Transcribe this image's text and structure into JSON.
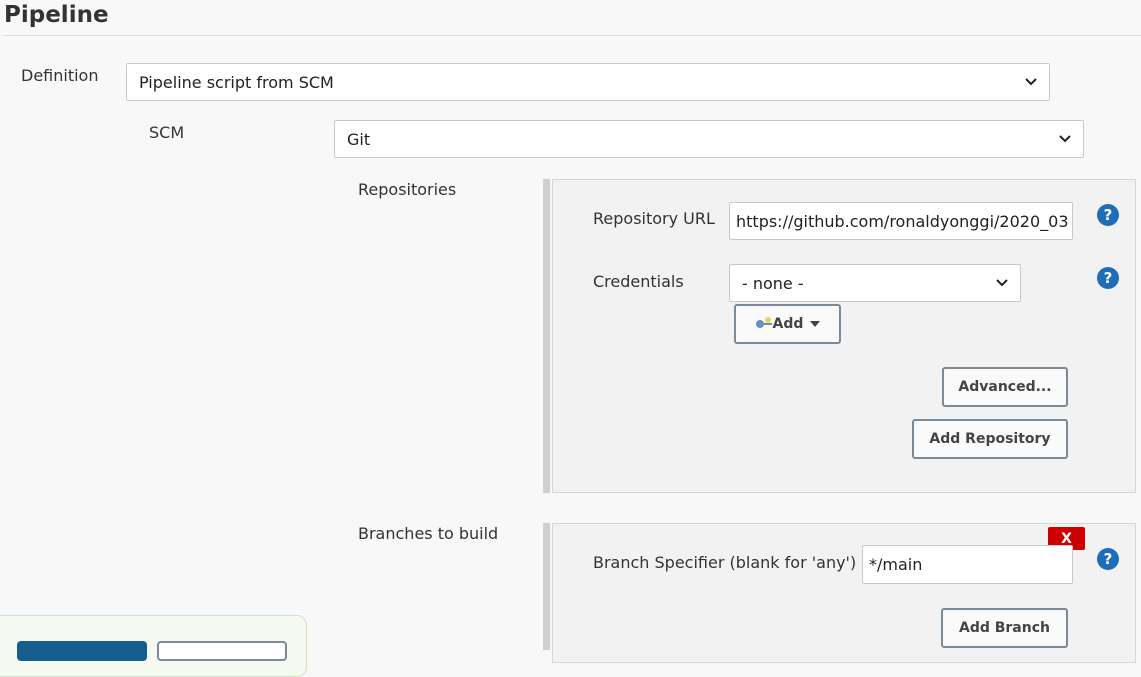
{
  "section": {
    "title": "Pipeline"
  },
  "definition": {
    "label": "Definition",
    "value": "Pipeline script from SCM"
  },
  "scm": {
    "label": "SCM",
    "value": "Git"
  },
  "repositories": {
    "label": "Repositories",
    "url_label": "Repository URL",
    "url_value": "https://github.com/ronaldyonggi/2020_03",
    "credentials_label": "Credentials",
    "credentials_value": "- none -",
    "add_label": "Add",
    "advanced_label": "Advanced...",
    "add_repository_label": "Add Repository"
  },
  "branches": {
    "label": "Branches to build",
    "specifier_label": "Branch Specifier (blank for 'any')",
    "specifier_value": "*/main",
    "delete_label": "X",
    "add_branch_label": "Add Branch"
  },
  "help": {
    "symbol": "?"
  },
  "icons": {
    "help": "help-icon",
    "chevron": "chevron-down-icon",
    "key": "key-icon",
    "caret": "caret-down-icon"
  },
  "colors": {
    "help": "#1e6db6",
    "delete": "#cc0000",
    "save": "#135e8e"
  }
}
